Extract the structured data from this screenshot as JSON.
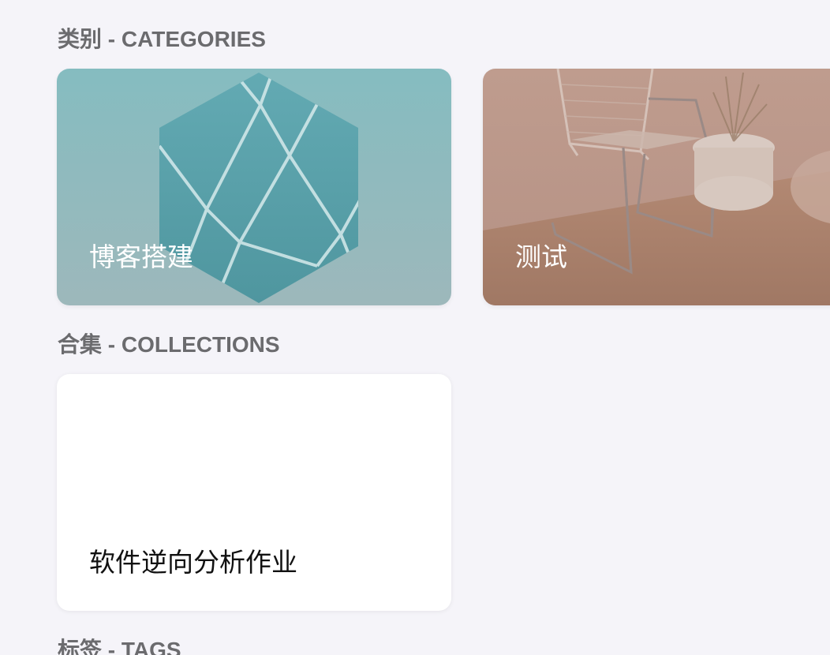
{
  "sections": {
    "categories": {
      "title": "类别 - CATEGORIES",
      "items": [
        {
          "label": "博客搭建"
        },
        {
          "label": "测试"
        }
      ]
    },
    "collections": {
      "title": "合集 - COLLECTIONS",
      "items": [
        {
          "label": "软件逆向分析作业"
        }
      ]
    },
    "tags": {
      "title": "标签 - TAGS"
    }
  },
  "colors": {
    "page_background": "#f5f4f9",
    "section_title": "#6b6b6e",
    "card_teal": "#7fb8be",
    "card_blush": "#b89083",
    "card_white": "#ffffff"
  }
}
